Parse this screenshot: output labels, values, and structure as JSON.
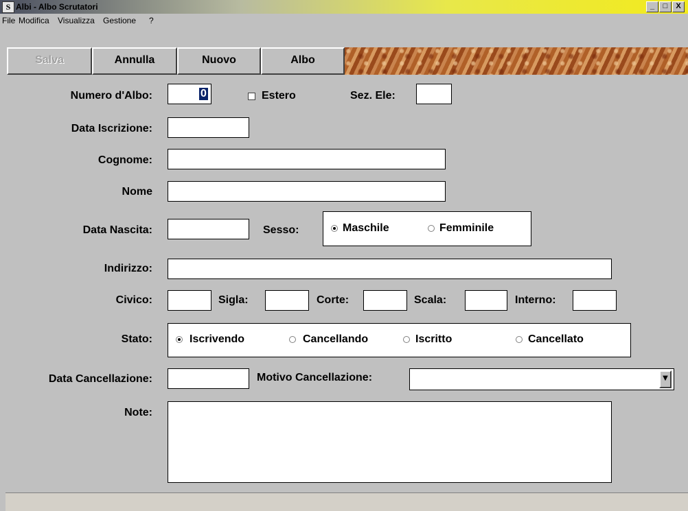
{
  "window": {
    "title": "Albi - Albo Scrutatori",
    "controls": {
      "minimize": "_",
      "maximize": "□",
      "close": "X"
    }
  },
  "menu": [
    "File",
    "Modifica",
    "Visualizza",
    "Gestione",
    "?"
  ],
  "toolbar": {
    "save": "Salva",
    "cancel": "Annulla",
    "new": "Nuovo",
    "albo": "Albo"
  },
  "form": {
    "numero_albo": {
      "label": "Numero d'Albo:",
      "value": "0"
    },
    "estero": {
      "label": "Estero",
      "checked": false
    },
    "sez_ele": {
      "label": "Sez. Ele:",
      "value": ""
    },
    "data_iscrizione": {
      "label": "Data Iscrizione:",
      "value": ""
    },
    "cognome": {
      "label": "Cognome:",
      "value": ""
    },
    "nome": {
      "label": "Nome",
      "value": ""
    },
    "data_nascita": {
      "label": "Data Nascita:",
      "value": ""
    },
    "sesso": {
      "label": "Sesso:",
      "options": [
        "Maschile",
        "Femminile"
      ],
      "selected": "Maschile"
    },
    "indirizzo": {
      "label": "Indirizzo:",
      "value": ""
    },
    "civico": {
      "label": "Civico:",
      "value": ""
    },
    "sigla": {
      "label": "Sigla:",
      "value": ""
    },
    "corte": {
      "label": "Corte:",
      "value": ""
    },
    "scala": {
      "label": "Scala:",
      "value": ""
    },
    "interno": {
      "label": "Interno:",
      "value": ""
    },
    "stato": {
      "label": "Stato:",
      "options": [
        "Iscrivendo",
        "Cancellando",
        "Iscritto",
        "Cancellato"
      ],
      "selected": "Iscrivendo"
    },
    "data_cancellazione": {
      "label": "Data Cancellazione:",
      "value": ""
    },
    "motivo_cancellazione": {
      "label": "Motivo Cancellazione:",
      "value": ""
    },
    "note": {
      "label": "Note:",
      "value": ""
    }
  },
  "icons": {
    "app": "s-logo-icon",
    "dropdown": "chevron-down-icon"
  }
}
